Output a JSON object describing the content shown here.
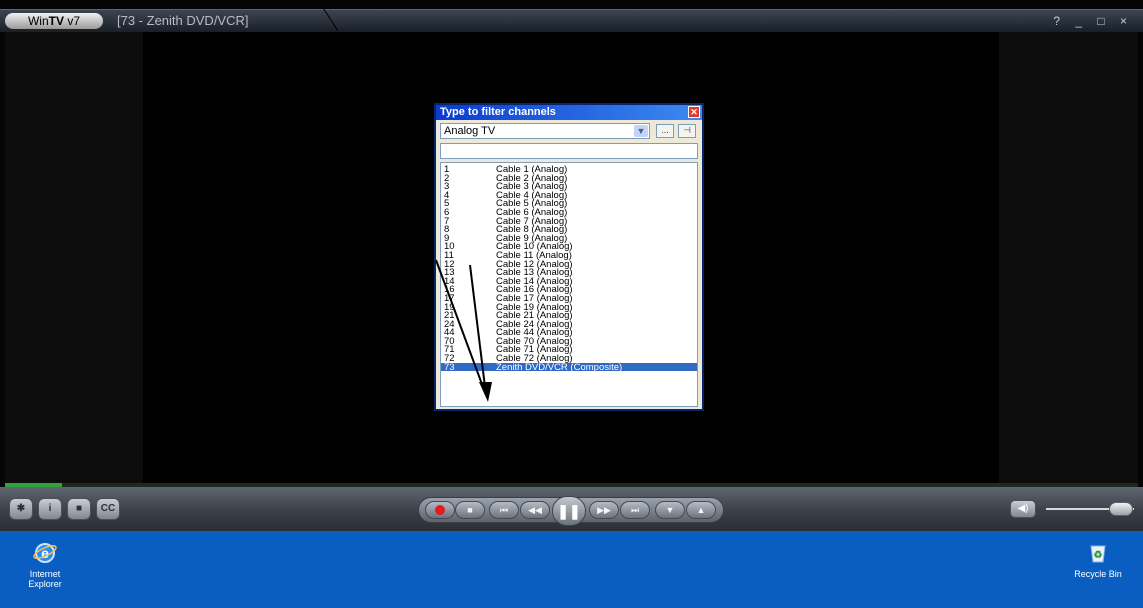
{
  "app": {
    "logo_prefix": "Win",
    "logo_bold": "TV",
    "logo_suffix": " v7",
    "window_title": "[73 - Zenith DVD/VCR]",
    "controls": {
      "help": "?",
      "minimize": "_",
      "maximize": "□",
      "close": "×"
    }
  },
  "playback": {
    "progress": 0.05
  },
  "toolbar": {
    "cc_label": "CC",
    "info_label": "i"
  },
  "volume": {
    "level": 0.85
  },
  "dialog": {
    "title": "Type to filter channels",
    "source": "Analog TV",
    "more_label": "...",
    "pin_label": "⊣",
    "filter_value": "",
    "channels": [
      {
        "num": "1",
        "name": "Cable 1  (Analog)"
      },
      {
        "num": "2",
        "name": "Cable 2  (Analog)"
      },
      {
        "num": "3",
        "name": "Cable 3  (Analog)"
      },
      {
        "num": "4",
        "name": "Cable 4  (Analog)"
      },
      {
        "num": "5",
        "name": "Cable 5  (Analog)"
      },
      {
        "num": "6",
        "name": "Cable 6  (Analog)"
      },
      {
        "num": "7",
        "name": "Cable 7  (Analog)"
      },
      {
        "num": "8",
        "name": "Cable 8  (Analog)"
      },
      {
        "num": "9",
        "name": "Cable 9  (Analog)"
      },
      {
        "num": "10",
        "name": "Cable 10  (Analog)"
      },
      {
        "num": "11",
        "name": "Cable 11  (Analog)"
      },
      {
        "num": "12",
        "name": "Cable 12  (Analog)"
      },
      {
        "num": "13",
        "name": "Cable 13  (Analog)"
      },
      {
        "num": "14",
        "name": "Cable 14  (Analog)"
      },
      {
        "num": "16",
        "name": "Cable 16  (Analog)"
      },
      {
        "num": "17",
        "name": "Cable 17  (Analog)"
      },
      {
        "num": "19",
        "name": "Cable 19  (Analog)"
      },
      {
        "num": "21",
        "name": "Cable 21  (Analog)"
      },
      {
        "num": "24",
        "name": "Cable 24  (Analog)"
      },
      {
        "num": "44",
        "name": "Cable 44  (Analog)"
      },
      {
        "num": "70",
        "name": "Cable 70  (Analog)"
      },
      {
        "num": "71",
        "name": "Cable 71  (Analog)"
      },
      {
        "num": "72",
        "name": "Cable 72  (Analog)"
      },
      {
        "num": "73",
        "name": "Zenith DVD/VCR  (Composite)",
        "selected": true
      }
    ]
  },
  "desktop": {
    "icons": [
      {
        "label_line1": "Internet",
        "label_line2": "Explorer",
        "icon": "internet-explorer-icon"
      },
      {
        "label_line1": "Recycle Bin",
        "label_line2": "",
        "icon": "recycle-bin-icon"
      }
    ]
  },
  "colors": {
    "selection": "#316ac5",
    "dialog_title": "#0a3ccf",
    "desktop": "#0a5ec2",
    "record": "#e41b1b"
  }
}
